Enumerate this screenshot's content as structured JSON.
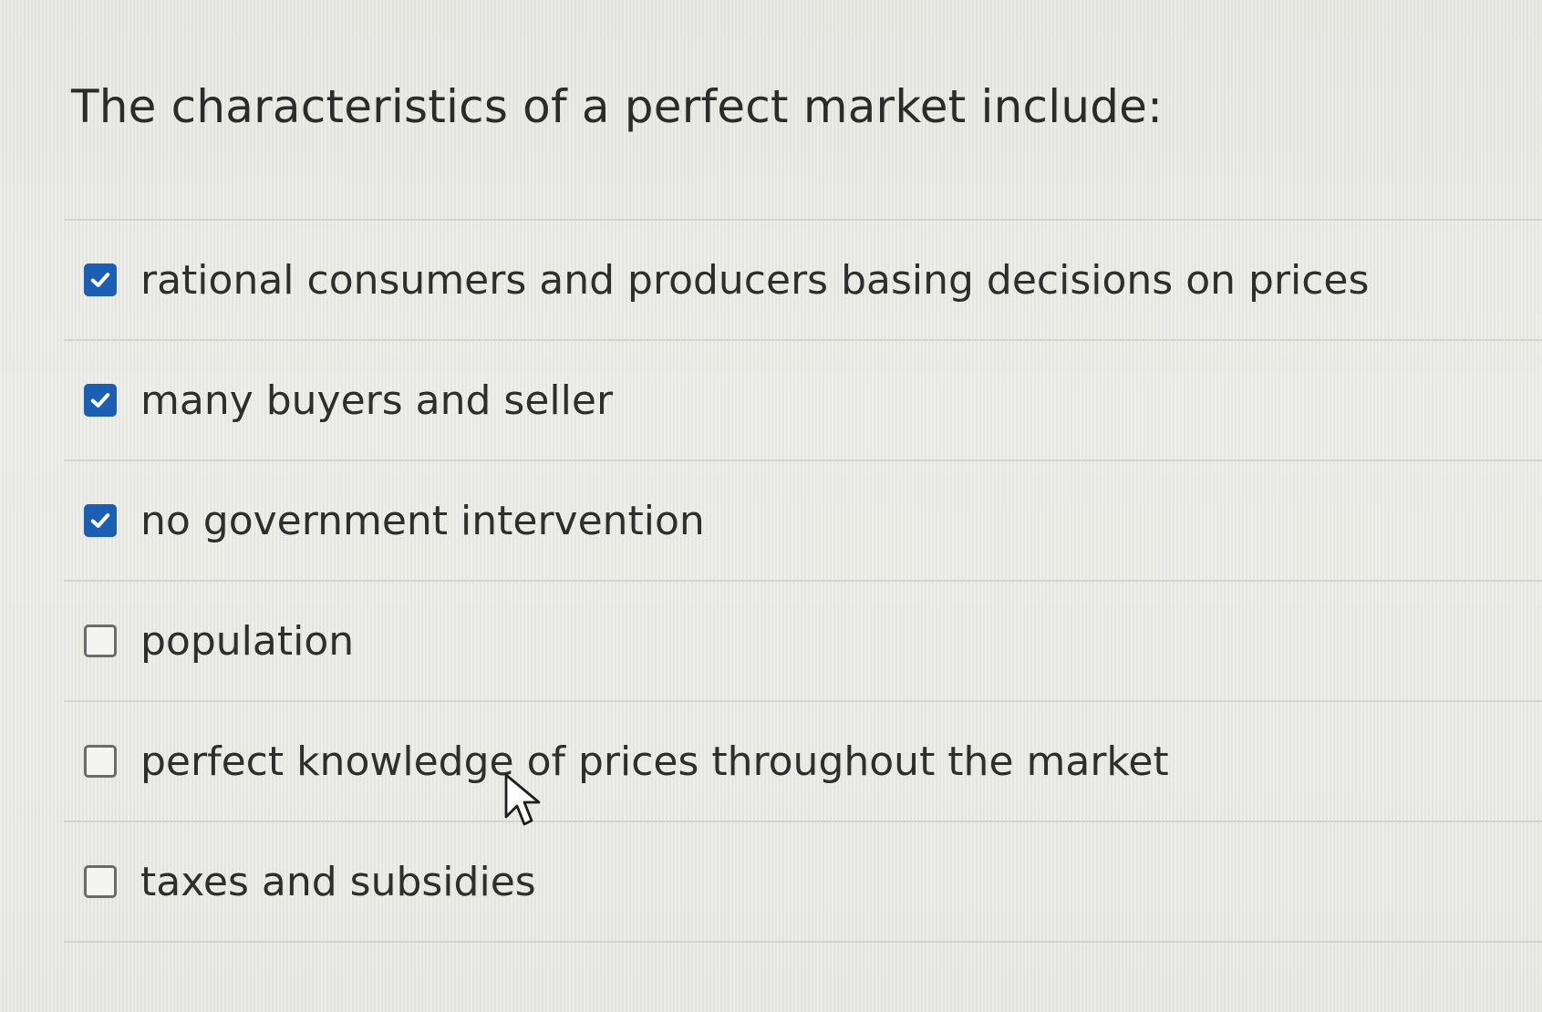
{
  "question": {
    "text": "The characteristics of a perfect market include:"
  },
  "options": [
    {
      "label": "rational consumers and producers basing decisions on prices",
      "checked": true
    },
    {
      "label": "many buyers and seller",
      "checked": true
    },
    {
      "label": "no government intervention",
      "checked": true
    },
    {
      "label": "population",
      "checked": false
    },
    {
      "label": "perfect knowledge of prices throughout the market",
      "checked": false
    },
    {
      "label": "taxes and subsidies",
      "checked": false
    }
  ],
  "colors": {
    "checkbox_checked": "#1a5fb4",
    "checkbox_border_unchecked": "#6b6b6b",
    "text": "#2e2e2e",
    "divider": "#d4d4cf"
  },
  "icons": {
    "checked": "checkmark-icon",
    "pointer": "mouse-pointer-icon"
  }
}
